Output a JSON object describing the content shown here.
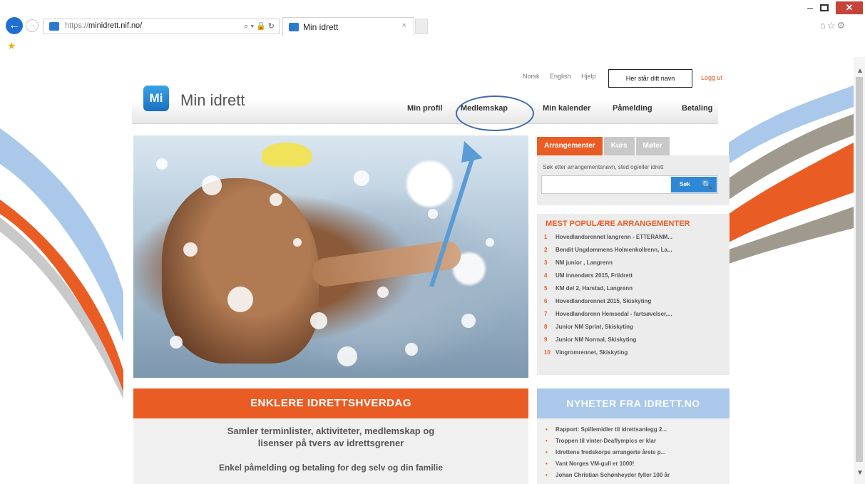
{
  "browser": {
    "url_prefix": "https://",
    "url_host": "minidrett.nif.no/",
    "address_icons": "⌕ ▾ 🔒 ↻",
    "tab_title": "Min idrett",
    "tab_close": "×",
    "win_min": "–",
    "win_close": "✕",
    "tools_icons": "⌂☆⚙",
    "back_glyph": "←",
    "fwd_glyph": "→",
    "fav_glyph": "★"
  },
  "site": {
    "lang_links": [
      "Norsk",
      "English",
      "Hjelp"
    ],
    "logout": "Logg ut",
    "name_box": "Her står ditt navn",
    "logo_mark": "Mi",
    "logo_text": "Min idrett",
    "nav": [
      "Min profil",
      "Medlemskap",
      "Min kalender",
      "Påmelding",
      "Betaling"
    ],
    "tabs": [
      "Arrangementer",
      "Kurs",
      "Møter"
    ],
    "search_hint": "Søk etter arrangementsnavn, sted og/eller idrett",
    "search_btn": "Søk",
    "search_glass": "🔍",
    "popular_title": "MEST POPULÆRE ARRANGEMENTER",
    "popular": [
      {
        "n": "1",
        "t": "Hovedlandsrennet langrenn - ETTERANM..."
      },
      {
        "n": "2",
        "t": "Bendit Ungdommens Holmenkollrenn, La..."
      },
      {
        "n": "3",
        "t": "NM junior , Langrenn"
      },
      {
        "n": "4",
        "t": "UM innendørs 2015, Friidrett"
      },
      {
        "n": "5",
        "t": "KM del 2, Harstad, Langrenn"
      },
      {
        "n": "6",
        "t": "Hovedlandsrennet 2015, Skiskyting"
      },
      {
        "n": "7",
        "t": "Hovedlandsrenn Hemsedal - fartsøvelser,..."
      },
      {
        "n": "8",
        "t": "Junior NM Sprint, Skiskyting"
      },
      {
        "n": "9",
        "t": "Junior NM Normal, Skiskyting"
      },
      {
        "n": "10",
        "t": "Vingromrennet, Skiskyting"
      }
    ],
    "banner_title": "ENKLERE IDRETTSHVERDAG",
    "banner_line1": "Samler terminlister, aktiviteter, medlemskap og",
    "banner_line2": "lisenser på tvers av idrettsgrener",
    "banner_line3": "Enkel påmelding og betaling for deg selv og din familie",
    "news_title": "NYHETER FRA IDRETT.NO",
    "news_bullet": "•",
    "news": [
      "Rapport: Spillemidler til idrettsanlegg 2...",
      "Troppen til vinter-Deaflympics er klar",
      "Idrettens fredskorps arrangerte årets p...",
      "Vant Norges VM-gull er 1000!",
      "Johan Christian Schønheyder fyller 100 år"
    ]
  },
  "colors": {
    "accent_orange": "#e95d25",
    "brand_blue": "#2a7ad0",
    "annotation_blue": "#5b9bd5"
  }
}
